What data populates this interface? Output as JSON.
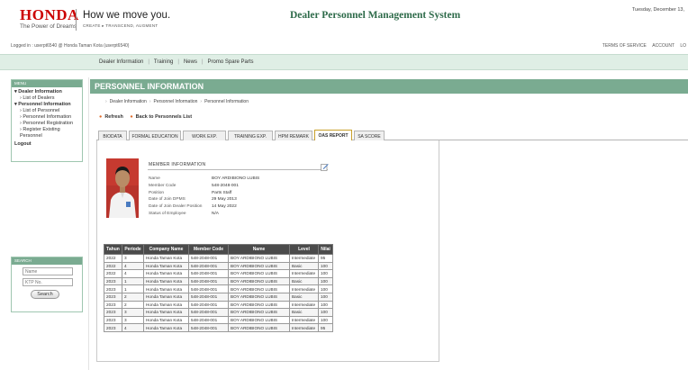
{
  "header": {
    "brand": "HONDA",
    "brand_tag": "The Power of Dreams",
    "slogan": "How we move you.",
    "slogan_sub": "CREATE ▸ TRANSCEND, AUGMENT",
    "system_title": "Dealer Personnel Management System",
    "date": "Tuesday, December 13,"
  },
  "login": {
    "status": "Logged in : userpt6540 @ Honda Taman Kota (userpt6540)",
    "terms": "TERMS OF SERVICE",
    "account": "ACCOUNT",
    "logout": "LO"
  },
  "topnav": [
    "Dealer Information",
    "Training",
    "News",
    "Promo Spare Parts"
  ],
  "sidebar": {
    "menu_header": "MENU",
    "groups": [
      {
        "label": "Dealer Information",
        "items": [
          "List of Dealers"
        ]
      },
      {
        "label": "Personnel Information",
        "items": [
          "List of Personnel",
          "Personnel Information",
          "Personnel Registration",
          "Register Existing Personnel"
        ]
      }
    ],
    "logout": "Logout",
    "search_header": "SEARCH",
    "search_name_placeholder": "Name",
    "search_ktp_placeholder": "KTP No.",
    "search_button": "Search"
  },
  "page": {
    "title": "PERSONNEL INFORMATION",
    "breadcrumb": [
      "Dealer Information",
      "Personnel Information",
      "Personnel Information"
    ],
    "refresh": "Refresh",
    "back": "Back to Personnels List"
  },
  "tabs": [
    "BIODATA",
    "FORMAL EDUCATION",
    "WORK EXP.",
    "TRAINING EXP.",
    "HPM REMARK",
    "OAS REPORT",
    "SA SCORE"
  ],
  "active_tab": "OAS REPORT",
  "member": {
    "title": "MEMBER INFORMATION",
    "fields": [
      {
        "label": "Name",
        "value": "BOY ARDIBIONO LUBIS"
      },
      {
        "label": "Member Code",
        "value": "548-2048-001"
      },
      {
        "label": "Position",
        "value": "Parts Staff"
      },
      {
        "label": "Date of Join DPMS",
        "value": "29 May 2013"
      },
      {
        "label": "Date of Join Dealer Position",
        "value": "14 May 2022"
      },
      {
        "label": "Status of Employee",
        "value": "N/A"
      }
    ]
  },
  "oas_table": {
    "headers": [
      "Tahun",
      "Periode",
      "Company Name",
      "Member Code",
      "Name",
      "Level",
      "Nilai"
    ],
    "rows": [
      [
        "2022",
        "3",
        "Honda Taman Kota",
        "548-2048-001",
        "BOY ARDIBIONO LUBIS",
        "Intermediate",
        "95"
      ],
      [
        "2022",
        "4",
        "Honda Taman Kota",
        "548-2048-001",
        "BOY ARDIBIONO LUBIS",
        "Basic",
        "100"
      ],
      [
        "2022",
        "4",
        "Honda Taman Kota",
        "548-2048-001",
        "BOY ARDIBIONO LUBIS",
        "Intermediate",
        "100"
      ],
      [
        "2023",
        "1",
        "Honda Taman Kota",
        "548-2048-001",
        "BOY ARDIBIONO LUBIS",
        "Basic",
        "100"
      ],
      [
        "2023",
        "1",
        "Honda Taman Kota",
        "548-2048-001",
        "BOY ARDIBIONO LUBIS",
        "Intermediate",
        "100"
      ],
      [
        "2023",
        "2",
        "Honda Taman Kota",
        "548-2048-001",
        "BOY ARDIBIONO LUBIS",
        "Basic",
        "100"
      ],
      [
        "2023",
        "2",
        "Honda Taman Kota",
        "548-2048-001",
        "BOY ARDIBIONO LUBIS",
        "Intermediate",
        "100"
      ],
      [
        "2023",
        "3",
        "Honda Taman Kota",
        "548-2048-001",
        "BOY ARDIBIONO LUBIS",
        "Basic",
        "100"
      ],
      [
        "2023",
        "3",
        "Honda Taman Kota",
        "548-2048-001",
        "BOY ARDIBIONO LUBIS",
        "Intermediate",
        "100"
      ],
      [
        "2023",
        "4",
        "Honda Taman Kota",
        "548-2048-001",
        "BOY ARDIBIONO LUBIS",
        "Intermediate",
        "95"
      ]
    ]
  },
  "colors": {
    "brand_red": "#cc0000",
    "accent_green": "#7aab91",
    "title_green": "#2e6b4a",
    "nav_bg": "#dfeee5",
    "active_tab_border": "#c8a02a"
  }
}
